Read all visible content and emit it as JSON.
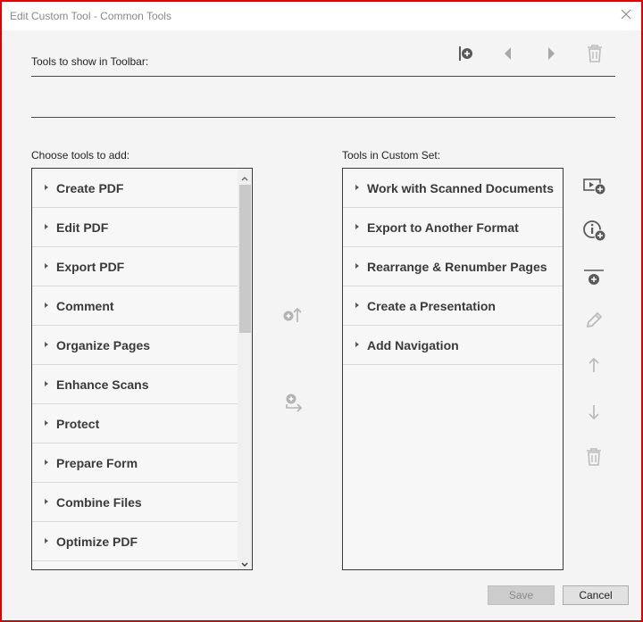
{
  "window": {
    "title": "Edit Custom Tool - Common Tools"
  },
  "toolbar_section": {
    "label": "Tools to show in Toolbar:"
  },
  "left_list": {
    "label": "Choose tools to add:",
    "items": [
      {
        "label": "Create PDF"
      },
      {
        "label": "Edit PDF"
      },
      {
        "label": "Export PDF"
      },
      {
        "label": "Comment"
      },
      {
        "label": "Organize Pages"
      },
      {
        "label": "Enhance Scans"
      },
      {
        "label": "Protect"
      },
      {
        "label": "Prepare Form"
      },
      {
        "label": "Combine Files"
      },
      {
        "label": "Optimize PDF"
      }
    ]
  },
  "right_list": {
    "label": "Tools in Custom Set:",
    "items": [
      {
        "label": "Work with Scanned Documents"
      },
      {
        "label": "Export to Another Format"
      },
      {
        "label": "Rearrange & Renumber Pages"
      },
      {
        "label": "Create a Presentation"
      },
      {
        "label": "Add Navigation"
      }
    ]
  },
  "buttons": {
    "save": "Save",
    "cancel": "Cancel"
  },
  "colors": {
    "frame_border": "#e00000",
    "icon_gray": "#7a7a7a",
    "icon_disabled": "#c2c2c2"
  }
}
